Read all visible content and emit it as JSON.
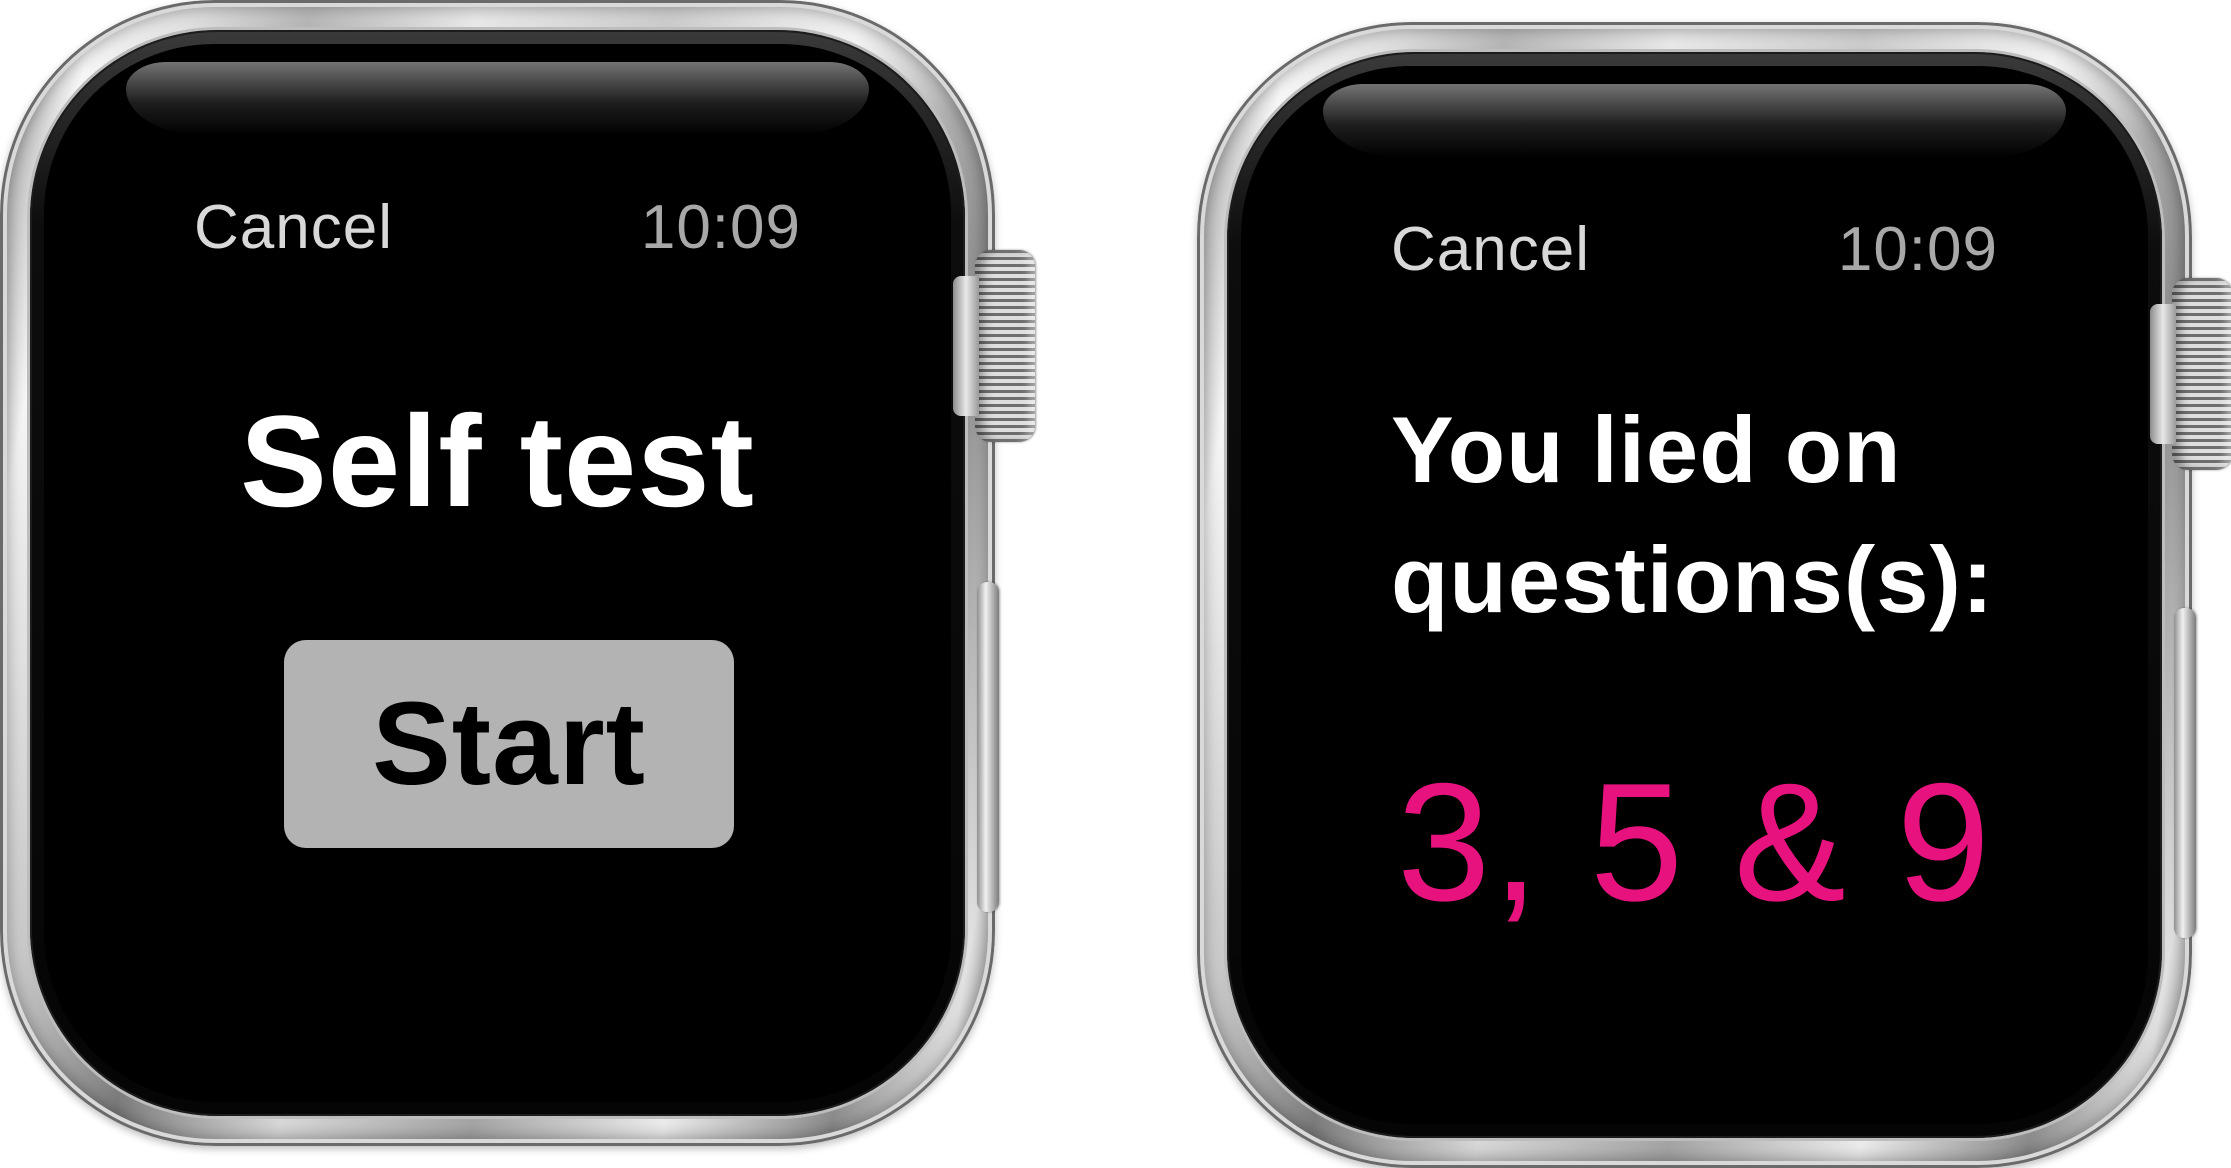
{
  "screens": [
    {
      "status": {
        "cancel_label": "Cancel",
        "time": "10:09"
      },
      "title": "Self test",
      "start_label": "Start"
    },
    {
      "status": {
        "cancel_label": "Cancel",
        "time": "10:09"
      },
      "message_line1": "You lied on",
      "message_line2": "questions(s):",
      "answer": "3, 5 & 9",
      "answer_color": "#e8127f"
    }
  ],
  "colors": {
    "screen_background": "#000000",
    "button_background": "#b3b3b3",
    "accent": "#e8127f"
  }
}
